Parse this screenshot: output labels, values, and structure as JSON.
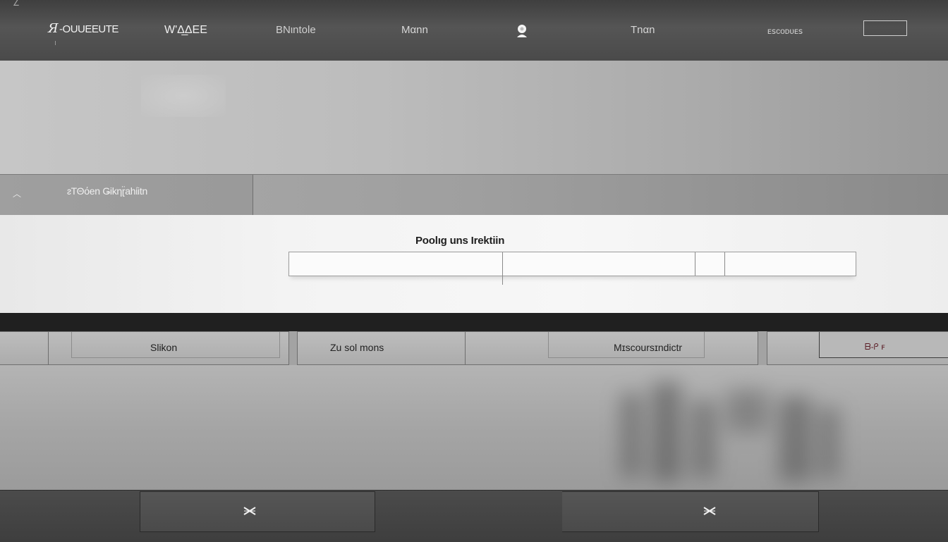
{
  "header": {
    "logo": "-OUUEEUTE",
    "logo_mark": "Я",
    "nav": [
      "W'Δ̲ΔΕΕ",
      "ΒΝιntole",
      "Mαnn",
      "Tnαn",
      "ᴇꜱᴄᴏᴅᴜᴇꜱ"
    ]
  },
  "subbar": {
    "label": "ᴤΤΘόen Ǥikηɽ̈ahίitn"
  },
  "panel": {
    "title": "Poolıg uns Irektiin"
  },
  "tabs": [
    "Slikon",
    "Zu sol mons",
    "Mɪscoursɪndictr",
    "ᗷ-ᑭ ꜰ"
  ],
  "icons": {
    "avatar": "user-avatar-icon",
    "chevron": "chevron-icon",
    "close": "close-icon"
  },
  "colors": {
    "topbar": "#4a4a4a",
    "panel": "#f3f3f3",
    "darkstrip": "#202020",
    "footer": "#444444"
  }
}
